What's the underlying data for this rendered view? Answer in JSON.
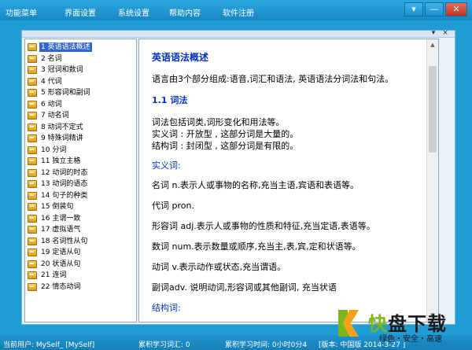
{
  "menu": [
    "功能菜单",
    "界面设置",
    "系统设置",
    "帮助内容",
    "软件注册"
  ],
  "window_buttons": [
    "▾",
    "—",
    "✕"
  ],
  "tree": {
    "items": [
      "1 英语语法概述",
      "2 名词",
      "3 冠词和数词",
      "4 代词",
      "5 形容词和副词",
      "6 动词",
      "7 动名词",
      "8 动词不定式",
      "9 特殊词精讲",
      "10 分词",
      "11 独立主格",
      "12 动词的时态",
      "13 动词的语态",
      "14 句子的种类",
      "15 倒装句",
      "16 主谓一致",
      "17 虚拟语气",
      "18 名词性从句",
      "19 定语从句",
      "20 状语从句",
      "21 连词",
      "22 情态动词"
    ],
    "selected_index": 0
  },
  "content": {
    "title": "英语语法概述",
    "intro": "语言由3个部分组成:语音,词汇和语法, 英语语法分词法和句法。",
    "section": "1.1  词法",
    "p1": "词法包括词类,词形变化和用法等。",
    "p2": "实义词 : 开放型 ,  这部分词是大量的。",
    "p3": "结构词 : 封闭型 ,  这部分词是有限的。",
    "sub1": "实义词:",
    "noun": "名词 n.表示人或事物的名称,充当主语,宾语和表语等。",
    "pron": "代词 pron.",
    "adj": "形容词 adj.表示人或事物的性质和特征,充当定语,表语等。",
    "num": "数词 num.表示数量或顺序,充当主,表,宾,定和状语等。",
    "verb": "动词 v.表示动作或状态,充当谓语。",
    "adv": "副词adv. 说明动词,形容词或其他副词, 充当状语",
    "sub2": "结构词:"
  },
  "status": {
    "user": "当前用户: MySelf_ [MySelf]",
    "words": "累积学习词汇: 0",
    "time": "累积学习时间: 0小时0分4",
    "version": "[版本: 中国版 2014-3-27 ]"
  },
  "watermark": {
    "main_kuai": "快",
    "main_rest": "盘下载",
    "sub": "绿色・安全・高速",
    "colors": {
      "green": "#7ab51d",
      "orange": "#f5a21b"
    }
  }
}
